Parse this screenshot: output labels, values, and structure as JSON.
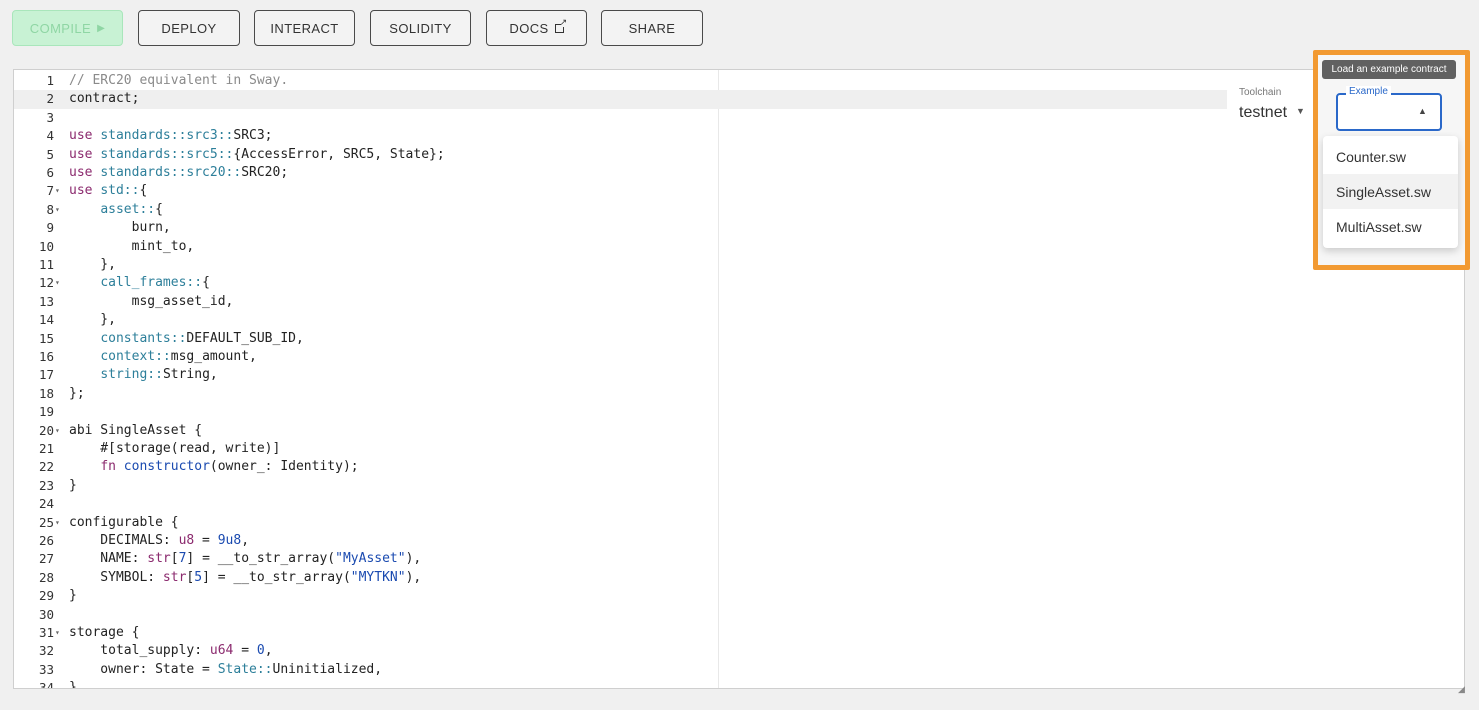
{
  "toolbar": {
    "compile_label": "COMPILE",
    "compile_icon": "play-icon",
    "deploy_label": "DEPLOY",
    "interact_label": "INTERACT",
    "solidity_label": "SOLIDITY",
    "docs_label": "DOCS",
    "docs_icon": "external-link-icon",
    "share_label": "SHARE"
  },
  "editor": {
    "active_line": 2,
    "lines": [
      {
        "num": "1",
        "fold": false,
        "html": "<span class=\"c\">// ERC20 equivalent in Sway.</span>"
      },
      {
        "num": "2",
        "fold": false,
        "html": "contract;"
      },
      {
        "num": "3",
        "fold": false,
        "html": ""
      },
      {
        "num": "4",
        "fold": false,
        "html": "<span class=\"k\">use</span> <span class=\"t\">standards::src3::</span>SRC3;"
      },
      {
        "num": "5",
        "fold": false,
        "html": "<span class=\"k\">use</span> <span class=\"t\">standards::src5::</span>{AccessError, SRC5, State};"
      },
      {
        "num": "6",
        "fold": false,
        "html": "<span class=\"k\">use</span> <span class=\"t\">standards::src20::</span>SRC20;"
      },
      {
        "num": "7",
        "fold": true,
        "html": "<span class=\"k\">use</span> <span class=\"t\">std::</span>{"
      },
      {
        "num": "8",
        "fold": true,
        "html": "    <span class=\"t\">asset::</span>{"
      },
      {
        "num": "9",
        "fold": false,
        "html": "        burn,"
      },
      {
        "num": "10",
        "fold": false,
        "html": "        mint_to,"
      },
      {
        "num": "11",
        "fold": false,
        "html": "    },"
      },
      {
        "num": "12",
        "fold": true,
        "html": "    <span class=\"t\">call_frames::</span>{"
      },
      {
        "num": "13",
        "fold": false,
        "html": "        msg_asset_id,"
      },
      {
        "num": "14",
        "fold": false,
        "html": "    },"
      },
      {
        "num": "15",
        "fold": false,
        "html": "    <span class=\"t\">constants::</span>DEFAULT_SUB_ID,"
      },
      {
        "num": "16",
        "fold": false,
        "html": "    <span class=\"t\">context::</span>msg_amount,"
      },
      {
        "num": "17",
        "fold": false,
        "html": "    <span class=\"t\">string::</span>String,"
      },
      {
        "num": "18",
        "fold": false,
        "html": "};"
      },
      {
        "num": "19",
        "fold": false,
        "html": ""
      },
      {
        "num": "20",
        "fold": true,
        "html": "abi SingleAsset {"
      },
      {
        "num": "21",
        "fold": false,
        "html": "    #[storage(read, write)]"
      },
      {
        "num": "22",
        "fold": false,
        "html": "    <span class=\"k\">fn</span> <span class=\"s\">constructor</span>(owner_: Identity);"
      },
      {
        "num": "23",
        "fold": false,
        "html": "}"
      },
      {
        "num": "24",
        "fold": false,
        "html": ""
      },
      {
        "num": "25",
        "fold": true,
        "html": "configurable {"
      },
      {
        "num": "26",
        "fold": false,
        "html": "    DECIMALS: <span class=\"k\">u8</span> = <span class=\"n\">9u8</span>,"
      },
      {
        "num": "27",
        "fold": false,
        "html": "    NAME: <span class=\"k\">str</span>[<span class=\"n\">7</span>] = __to_str_array(<span class=\"s\">\"MyAsset\"</span>),"
      },
      {
        "num": "28",
        "fold": false,
        "html": "    SYMBOL: <span class=\"k\">str</span>[<span class=\"n\">5</span>] = __to_str_array(<span class=\"s\">\"MYTKN\"</span>),"
      },
      {
        "num": "29",
        "fold": false,
        "html": "}"
      },
      {
        "num": "30",
        "fold": false,
        "html": ""
      },
      {
        "num": "31",
        "fold": true,
        "html": "storage {"
      },
      {
        "num": "32",
        "fold": false,
        "html": "    total_supply: <span class=\"k\">u64</span> = <span class=\"n\">0</span>,"
      },
      {
        "num": "33",
        "fold": false,
        "html": "    owner: State = <span class=\"t\">State::</span>Uninitialized,"
      },
      {
        "num": "34",
        "fold": false,
        "html": "}"
      }
    ]
  },
  "toolchain": {
    "label": "Toolchain",
    "value": "testnet"
  },
  "example": {
    "tooltip": "Load an example contract",
    "label": "Example",
    "options": [
      "Counter.sw",
      "SingleAsset.sw",
      "MultiAsset.sw"
    ],
    "hovered_index": 1
  },
  "colors": {
    "highlight_border": "#f29a32",
    "compile_bg": "#c8f2d4",
    "focus_blue": "#2a68c9"
  }
}
